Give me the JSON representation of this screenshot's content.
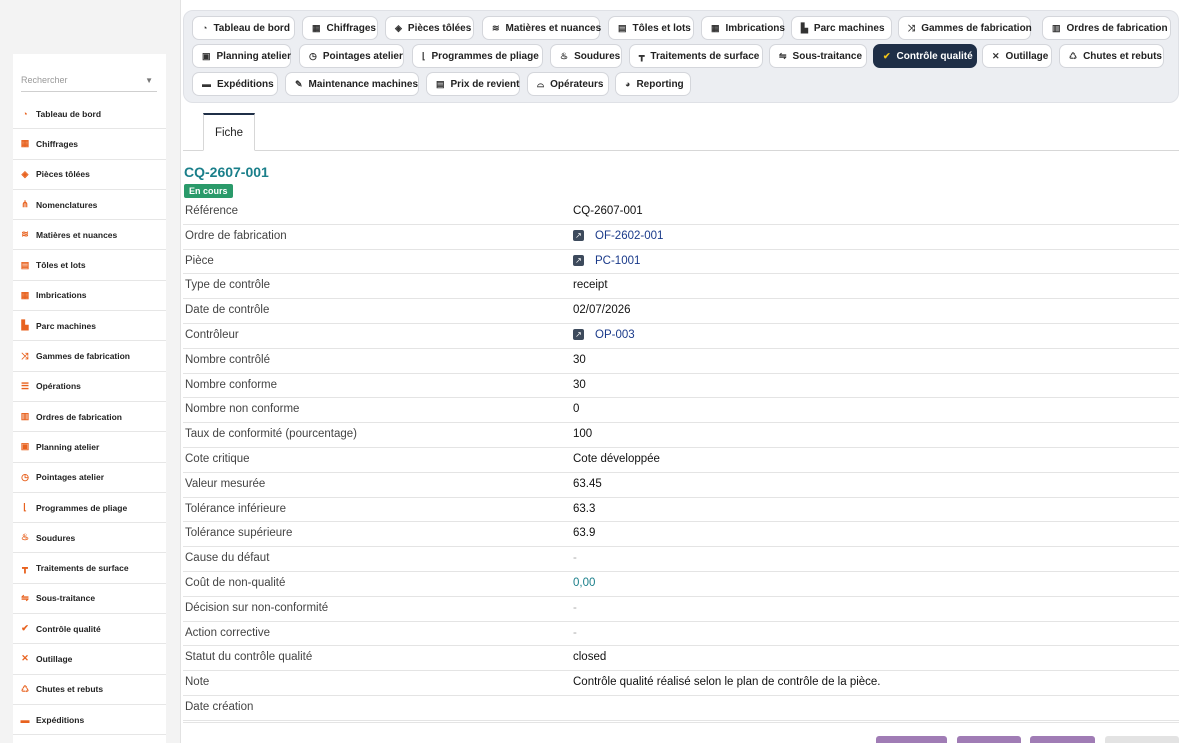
{
  "sidebar": {
    "search_placeholder": "Rechercher",
    "items": [
      {
        "label": "Tableau de bord",
        "icon": "dashboard-icon"
      },
      {
        "label": "Chiffrages",
        "icon": "calculator-icon"
      },
      {
        "label": "Pièces tôlées",
        "icon": "cube-icon"
      },
      {
        "label": "Nomenclatures",
        "icon": "tree-icon"
      },
      {
        "label": "Matières et nuances",
        "icon": "layers-icon"
      },
      {
        "label": "Tôles et lots",
        "icon": "sheets-icon"
      },
      {
        "label": "Imbrications",
        "icon": "grid-icon"
      },
      {
        "label": "Parc machines",
        "icon": "factory-icon"
      },
      {
        "label": "Gammes de fabrication",
        "icon": "flow-icon"
      },
      {
        "label": "Opérations",
        "icon": "list-icon"
      },
      {
        "label": "Ordres de fabrication",
        "icon": "clipboard-icon"
      },
      {
        "label": "Planning atelier",
        "icon": "calendar-icon"
      },
      {
        "label": "Pointages atelier",
        "icon": "clock-icon"
      },
      {
        "label": "Programmes de pliage",
        "icon": "bend-icon"
      },
      {
        "label": "Soudures",
        "icon": "flame-icon"
      },
      {
        "label": "Traitements de surface",
        "icon": "paint-roller-icon"
      },
      {
        "label": "Sous-traitance",
        "icon": "handshake-icon"
      },
      {
        "label": "Contrôle qualité",
        "icon": "check-icon"
      },
      {
        "label": "Outillage",
        "icon": "tools-icon"
      },
      {
        "label": "Chutes et rebuts",
        "icon": "recycle-icon"
      },
      {
        "label": "Expéditions",
        "icon": "truck-icon"
      }
    ]
  },
  "topnav": {
    "row1": [
      "Tableau de bord",
      "Chiffrages",
      "Pièces tôlées",
      "Matières et nuances",
      "Tôles et lots",
      "Imbrications",
      "Parc machines",
      "Gammes de fabrication",
      "Ordres de fabrication"
    ],
    "row2": [
      "Planning atelier",
      "Pointages atelier",
      "Programmes de pliage",
      "Soudures",
      "Traitements de surface",
      "Sous-traitance",
      "Contrôle qualité",
      "Outillage",
      "Chutes et rebuts"
    ],
    "row3": [
      "Expéditions",
      "Maintenance machines",
      "Prix de revient",
      "Opérateurs",
      "Reporting"
    ],
    "active": "Contrôle qualité"
  },
  "tab": {
    "label": "Fiche"
  },
  "record": {
    "title": "CQ-2607-001",
    "status_badge": "En cours",
    "fields": [
      {
        "label": "Référence",
        "value": "CQ-2607-001",
        "kind": "text"
      },
      {
        "label": "Ordre de fabrication",
        "value": "OF-2602-001",
        "kind": "link"
      },
      {
        "label": "Pièce",
        "value": "PC-1001",
        "kind": "link"
      },
      {
        "label": "Type de contrôle",
        "value": "receipt",
        "kind": "text"
      },
      {
        "label": "Date de contrôle",
        "value": "02/07/2026",
        "kind": "text"
      },
      {
        "label": "Contrôleur",
        "value": "OP-003",
        "kind": "link"
      },
      {
        "label": "Nombre contrôlé",
        "value": "30",
        "kind": "text"
      },
      {
        "label": "Nombre conforme",
        "value": "30",
        "kind": "text"
      },
      {
        "label": "Nombre non conforme",
        "value": "0",
        "kind": "text"
      },
      {
        "label": "Taux de conformité (pourcentage)",
        "value": "100",
        "kind": "text"
      },
      {
        "label": "Cote critique",
        "value": "Cote développée",
        "kind": "text"
      },
      {
        "label": "Valeur mesurée",
        "value": "63.45",
        "kind": "text"
      },
      {
        "label": "Tolérance inférieure",
        "value": "63.3",
        "kind": "text"
      },
      {
        "label": "Tolérance supérieure",
        "value": "63.9",
        "kind": "text"
      },
      {
        "label": "Cause du défaut",
        "value": "-",
        "kind": "muted"
      },
      {
        "label": "Coût de non-qualité",
        "value": "0,00",
        "kind": "money"
      },
      {
        "label": "Décision sur non-conformité",
        "value": "-",
        "kind": "muted"
      },
      {
        "label": "Action corrective",
        "value": "-",
        "kind": "muted"
      },
      {
        "label": "Statut du contrôle qualité",
        "value": "closed",
        "kind": "text"
      },
      {
        "label": "Note",
        "value": "Contrôle qualité réalisé selon le plan de contrôle de la pièce.",
        "kind": "text"
      },
      {
        "label": "Date création",
        "value": "",
        "kind": "text"
      }
    ]
  },
  "colors": {
    "accent": "#e8621f",
    "nav_active": "#1f2f47",
    "title": "#1a7f8a",
    "badge": "#2a9a6a",
    "action_button": "#a07cb5"
  }
}
